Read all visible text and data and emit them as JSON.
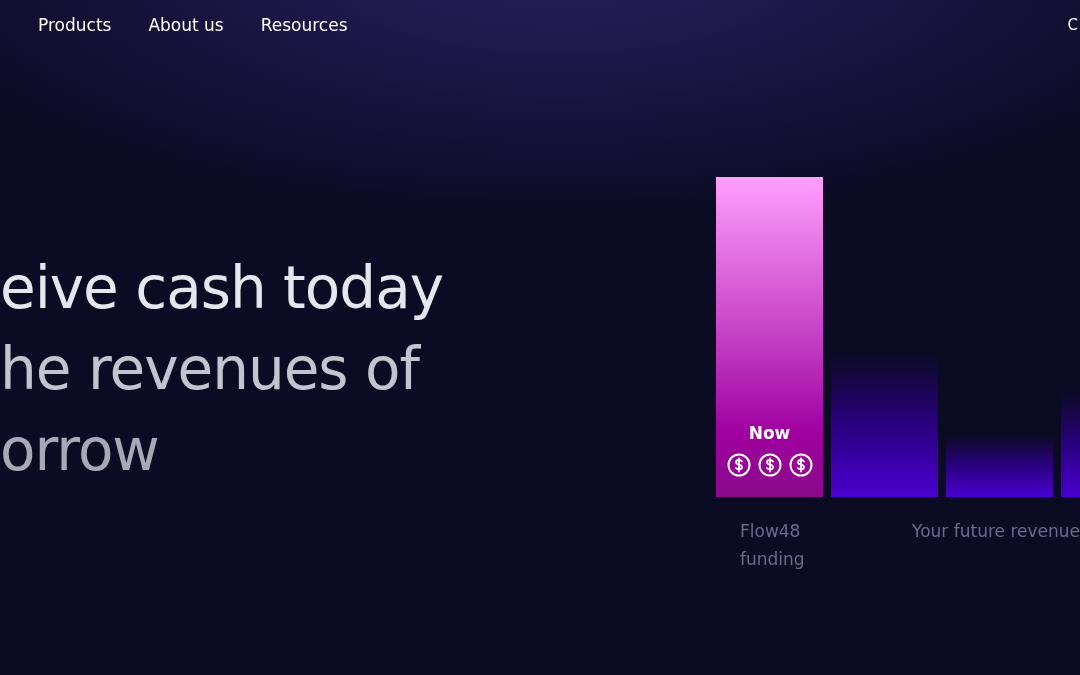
{
  "nav": {
    "items": [
      "Products",
      "About us",
      "Resources"
    ],
    "right_cut": "C"
  },
  "headline": {
    "lines": [
      "eive cash today",
      "he revenues of",
      "orrow"
    ]
  },
  "illustration": {
    "now_label": "Now",
    "bars": [
      {
        "kind": "highlight"
      },
      {
        "kind": "plain"
      },
      {
        "kind": "plain"
      },
      {
        "kind": "plain"
      }
    ],
    "caption_left": "Flow48 funding",
    "caption_right": "Your future revenue"
  }
}
